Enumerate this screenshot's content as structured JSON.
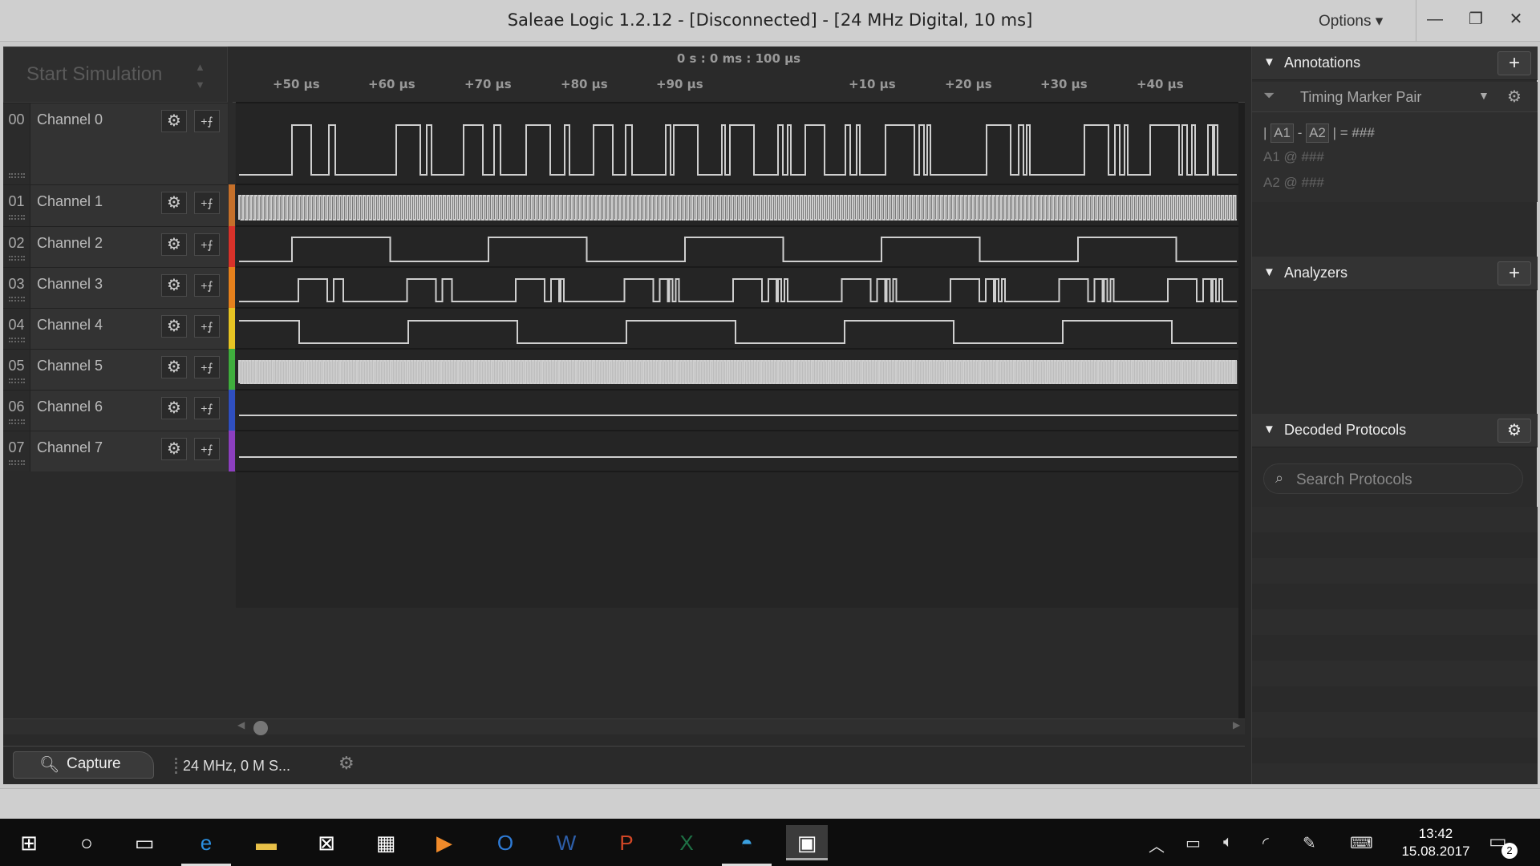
{
  "window": {
    "title": "Saleae Logic 1.2.12 - [Disconnected] - [24 MHz Digital, 10 ms]",
    "options_label": "Options",
    "minimize": "—",
    "restore": "❐",
    "close": "✕"
  },
  "toolbar": {
    "start_simulation": "Start Simulation"
  },
  "ruler": {
    "center_label": "0 s : 0 ms : 100 μs",
    "ticks": [
      "+50 μs",
      "+60 μs",
      "+70 μs",
      "+80 μs",
      "+90 μs",
      "+10 μs",
      "+20 μs",
      "+30 μs",
      "+40 μs"
    ]
  },
  "channels": [
    {
      "num": "00",
      "name": "Channel 0",
      "color": "#2b2b2b"
    },
    {
      "num": "01",
      "name": "Channel 1",
      "color": "#c6702a"
    },
    {
      "num": "02",
      "name": "Channel 2",
      "color": "#d8322a"
    },
    {
      "num": "03",
      "name": "Channel 3",
      "color": "#e6811c"
    },
    {
      "num": "04",
      "name": "Channel 4",
      "color": "#e7c423"
    },
    {
      "num": "05",
      "name": "Channel 5",
      "color": "#3fae3d"
    },
    {
      "num": "06",
      "name": "Channel 6",
      "color": "#2f4fc0"
    },
    {
      "num": "07",
      "name": "Channel 7",
      "color": "#8c3fbf"
    }
  ],
  "bottom": {
    "capture_label": "Capture",
    "rate_label": "24 MHz, 0 M S..."
  },
  "annotations": {
    "header": "Annotations",
    "add": "+",
    "marker_pair": "Timing Marker Pair",
    "line1_prefix": "|",
    "a1": "A1",
    "dash": "-",
    "a2": "A2",
    "line1_suffix": "| = ###",
    "line2": "A1 @ ###",
    "line3": "A2 @ ###"
  },
  "analyzers": {
    "header": "Analyzers",
    "add": "+"
  },
  "decoded": {
    "header": "Decoded Protocols",
    "search_placeholder": "Search Protocols"
  },
  "taskbar": {
    "time": "13:42",
    "date": "15.08.2017",
    "notifications": "2"
  }
}
